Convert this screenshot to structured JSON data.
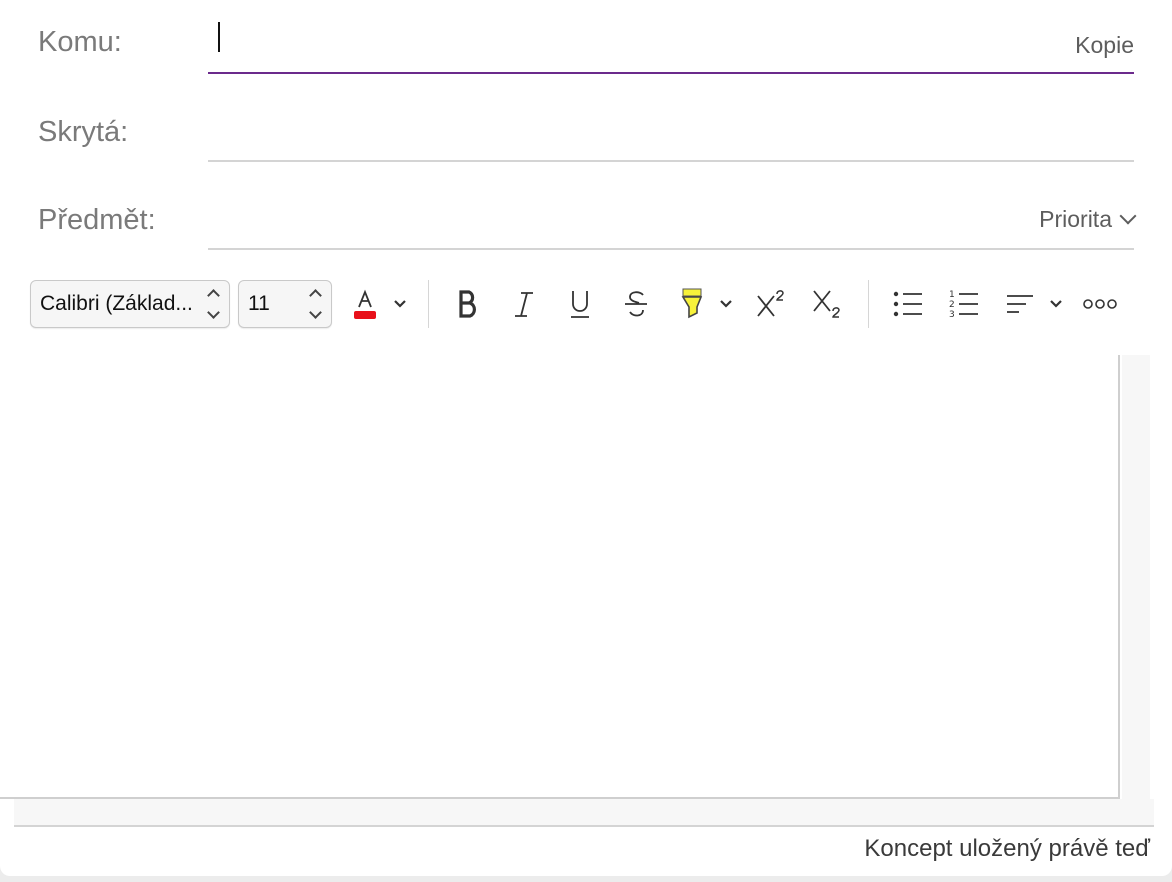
{
  "header": {
    "to_label": "Komu:",
    "cc_label": "Kopie",
    "bcc_label": "Skrytá:",
    "subject_label": "Předmět:",
    "priority_label": "Priorita",
    "active_line_color": "#6b2a8c"
  },
  "toolbar": {
    "font_name": "Calibri (Základ...",
    "font_size": "11",
    "font_color": "#e8101a",
    "highlight_color": "#f7f23a",
    "icons": [
      "font-color-icon",
      "bold-icon",
      "italic-icon",
      "underline-icon",
      "strikethrough-icon",
      "highlighter-icon",
      "superscript-icon",
      "subscript-icon",
      "bulleted-list-icon",
      "numbered-list-icon",
      "align-left-icon",
      "more-icon"
    ]
  },
  "status": {
    "draft_saved": "Koncept uložený právě teď"
  }
}
